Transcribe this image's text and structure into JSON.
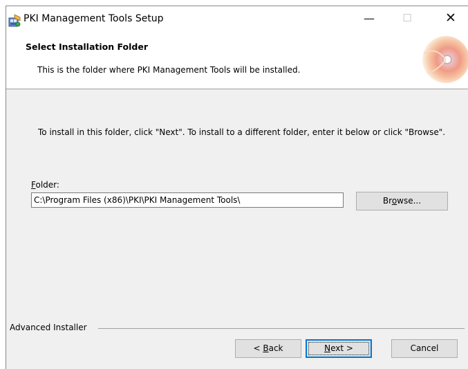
{
  "window": {
    "title": "PKI Management Tools Setup",
    "min_glyph": "—",
    "max_glyph": "☐",
    "close_glyph": "✕"
  },
  "banner": {
    "title": "Select Installation Folder",
    "subtitle": "This is the folder where PKI Management Tools will be installed."
  },
  "main": {
    "instructions": "To install in this folder, click \"Next\". To install to a different folder, enter it below or click \"Browse\".",
    "folder_label_accel": "F",
    "folder_label_rest": "older:",
    "folder_value": "C:\\Program Files (x86)\\PKI\\PKI Management Tools\\",
    "browse_pre": "Br",
    "browse_accel": "o",
    "browse_post": "wse..."
  },
  "footer": {
    "group_label": "Advanced Installer",
    "back_pre": "< ",
    "back_accel": "B",
    "back_post": "ack",
    "next_accel": "N",
    "next_post": "ext >",
    "cancel_label": "Cancel"
  },
  "colors": {
    "focus_border": "#0078d7",
    "dialog_bg": "#f0f0f0"
  }
}
